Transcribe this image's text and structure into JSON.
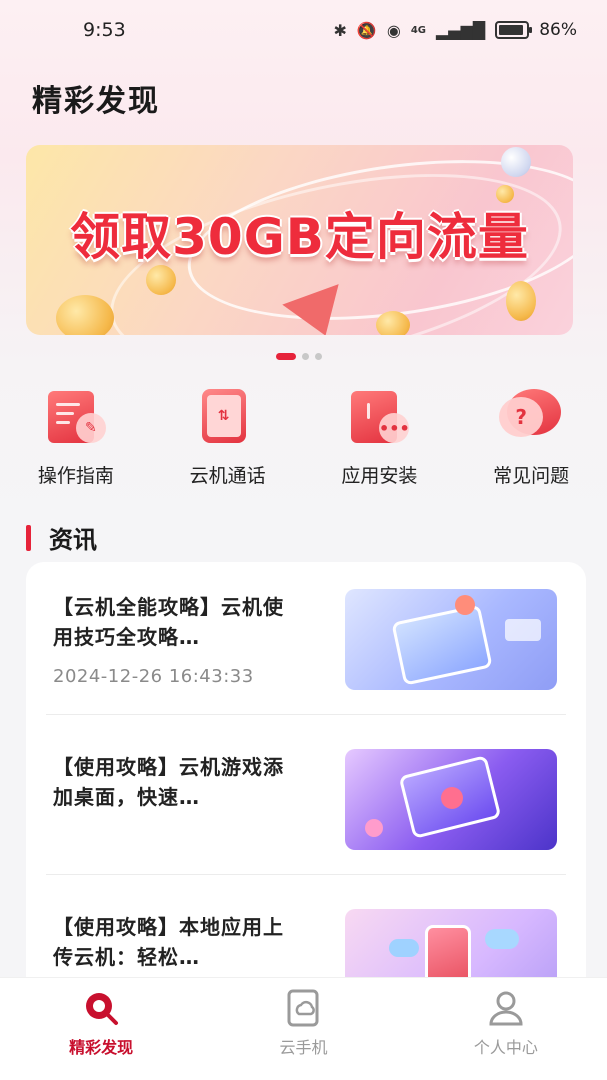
{
  "status_bar": {
    "time": "9:53",
    "network": "4G",
    "battery": "86%"
  },
  "page": {
    "title": "精彩发现"
  },
  "banner": {
    "text": "领取30GB定向流量",
    "slides": 3,
    "active_slide": 1
  },
  "quick_actions": [
    {
      "label": "操作指南",
      "icon": "guide-doc-icon"
    },
    {
      "label": "云机通话",
      "icon": "cloud-phone-call-icon"
    },
    {
      "label": "应用安装",
      "icon": "app-install-icon"
    },
    {
      "label": "常见问题",
      "icon": "faq-bubble-icon"
    }
  ],
  "news_section": {
    "title": "资讯",
    "items": [
      {
        "title": "【云机全能攻略】云机使用技巧全攻略…",
        "date": "2024-12-26 16:43:33",
        "thumb_colors": [
          "#c9d6ff",
          "#6f86f2"
        ]
      },
      {
        "title": "【使用攻略】云机游戏添加桌面，快速…",
        "date": "",
        "thumb_colors": [
          "#d8c2ff",
          "#6b4be0"
        ]
      },
      {
        "title": "【使用攻略】本地应用上传云机：轻松…",
        "date": "",
        "thumb_colors": [
          "#f3c6ea",
          "#b58cf2"
        ]
      }
    ]
  },
  "tabbar": {
    "tabs": [
      {
        "label": "精彩发现",
        "icon": "discover-icon",
        "active": true
      },
      {
        "label": "云手机",
        "icon": "cloud-phone-icon",
        "active": false
      },
      {
        "label": "个人中心",
        "icon": "profile-icon",
        "active": false
      }
    ]
  },
  "colors": {
    "accent": "#e6233a",
    "active_tab": "#c8102e"
  }
}
